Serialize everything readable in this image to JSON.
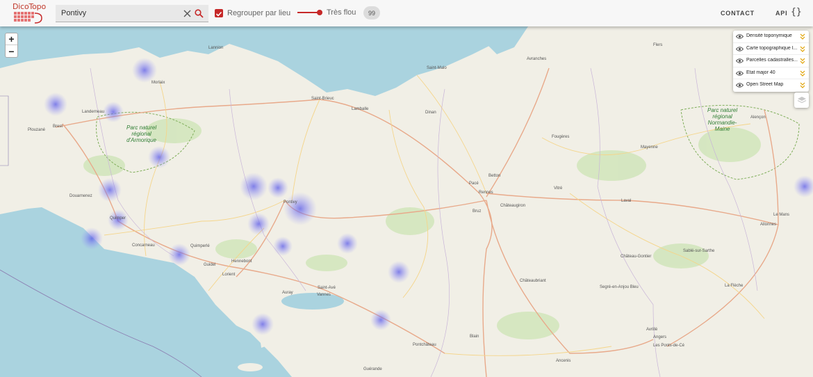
{
  "header": {
    "logo_text": "DicoTopo",
    "search": {
      "value": "Pontivy",
      "placeholder": ""
    },
    "group_label": "Regrouper par lieu",
    "blur_label": "Très flou",
    "count_badge": "99",
    "contact_label": "CONTACT",
    "api_label": "API",
    "api_brace": "{}"
  },
  "colors": {
    "accent": "#c62828",
    "sea": "#aad3df",
    "land": "#f2efe9",
    "heat": "#6e6cf0"
  },
  "zoom": {
    "in": "+",
    "out": "−"
  },
  "layers": [
    {
      "label": "Densité toponymique"
    },
    {
      "label": "Carte topographique I..."
    },
    {
      "label": "Parcelles cadastralles..."
    },
    {
      "label": "Etat major 40"
    },
    {
      "label": "Open Street Map"
    }
  ],
  "map_labels": {
    "lannion": "Lannion",
    "morlaix": "Morlaix",
    "brest": "Brest",
    "plouzane": "Plouzané",
    "landerneau": "Landerneau",
    "saint_brieuc": "Saint-Brieuc",
    "lamballe": "Lamballe",
    "dinan": "Dinan",
    "saint_malo": "Saint-Malo",
    "avranches": "Avranches",
    "flers": "Flers",
    "fougeres": "Fougères",
    "mayenne": "Mayenne",
    "alencon": "Alençon",
    "douarnenez": "Douarnenez",
    "quimper": "Quimper",
    "concarneau": "Concarneau",
    "quimperle": "Quimperlé",
    "guidel": "Guidel",
    "lorient": "Lorient",
    "hennebont": "Hennebont",
    "pontivy": "Pontivy",
    "auray": "Auray",
    "saint_ave": "Saint-Avé",
    "vannes": "Vannes",
    "rennes": "Rennes",
    "pace": "Pacé",
    "betton": "Betton",
    "bruz": "Bruz",
    "chateaugiron": "Châteaugiron",
    "vitre": "Vitré",
    "laval": "Laval",
    "le_mans": "Le Mans",
    "allonnes": "Allonnes",
    "chateau_gontier": "Château-Gontier",
    "sable": "Sablé-sur-Sarthe",
    "chateaubriant": "Châteaubriant",
    "segre": "Segré-en-Anjou Bleu",
    "la_fleche": "La Flèche",
    "avrille": "Avrillé",
    "angers": "Angers",
    "ponts_de_ce": "Les Ponts-de-Cé",
    "blain": "Blain",
    "pontchateau": "Pontchâteau",
    "ancenis": "Ancenis",
    "guerande": "Guérande"
  },
  "parks": {
    "armorique": "Parc naturel\nrégional\nd'Armorique",
    "normandie": "Parc naturel\nrégional\nNormandie-\nMaine"
  },
  "heat_points": [
    {
      "name": "morlaix"
    },
    {
      "name": "brest-north"
    },
    {
      "name": "landerneau"
    },
    {
      "name": "monts-arree"
    },
    {
      "name": "chateaulin"
    },
    {
      "name": "quimper"
    },
    {
      "name": "pont-labbe"
    },
    {
      "name": "quimperle"
    },
    {
      "name": "centre-1"
    },
    {
      "name": "centre-2"
    },
    {
      "name": "pontivy"
    },
    {
      "name": "centre-3"
    },
    {
      "name": "baud"
    },
    {
      "name": "ploermel"
    },
    {
      "name": "redon"
    },
    {
      "name": "quiberon"
    },
    {
      "name": "la-roche-bernard"
    },
    {
      "name": "le-mans-east"
    }
  ]
}
